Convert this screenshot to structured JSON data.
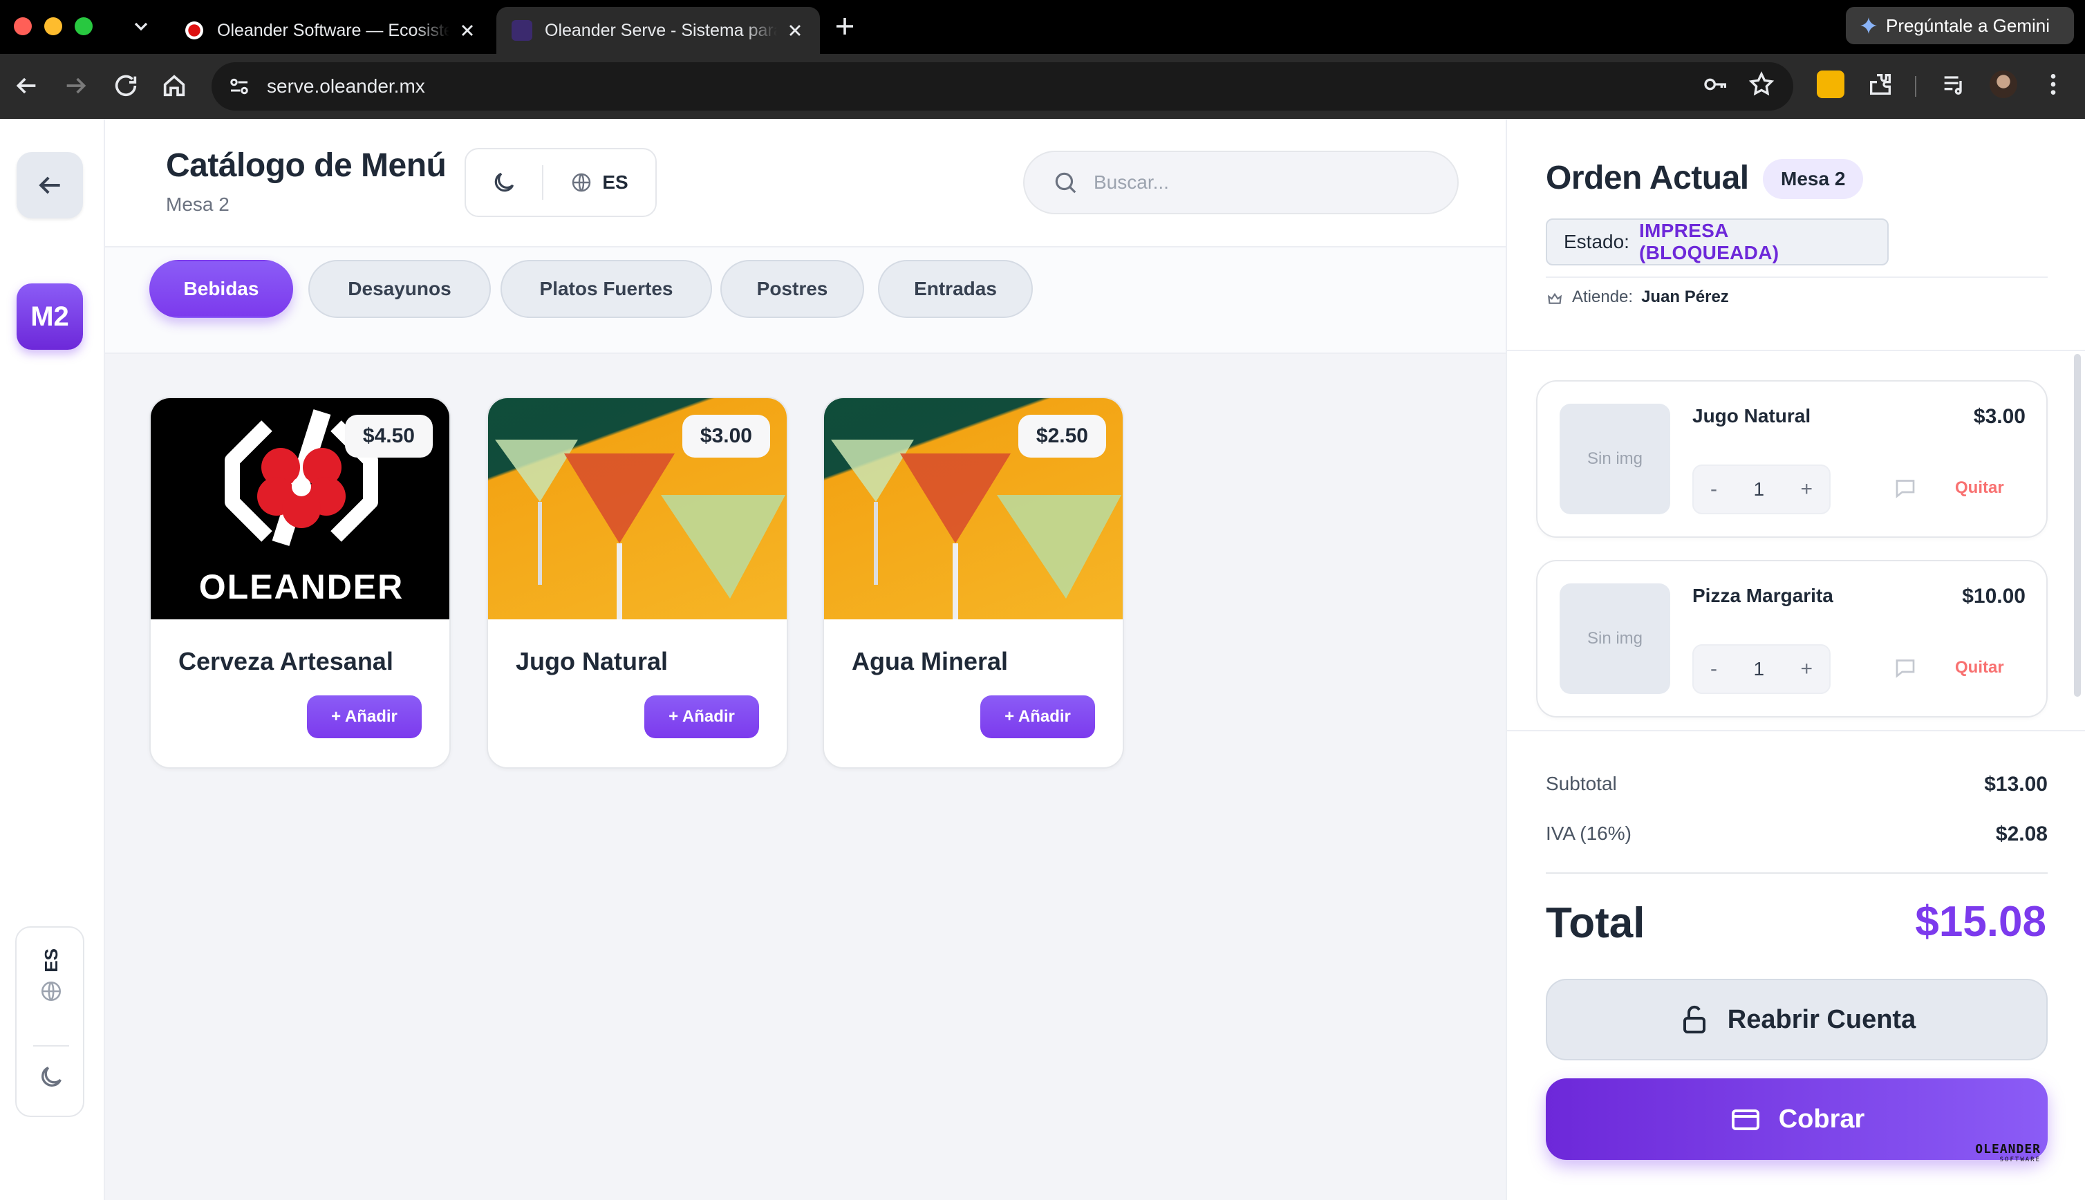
{
  "browser": {
    "tabs": [
      {
        "title": "Oleander Software — Ecosistema"
      },
      {
        "title": "Oleander Serve - Sistema para"
      }
    ],
    "gemini_label": "Pregúntale a Gemini",
    "url": "serve.oleander.mx"
  },
  "rail": {
    "badge": "M2",
    "lang": "ES"
  },
  "header": {
    "title": "Catálogo de Menú",
    "subtitle": "Mesa 2",
    "lang": "ES",
    "search_placeholder": "Buscar..."
  },
  "categories": [
    {
      "label": "Bebidas",
      "active": true
    },
    {
      "label": "Desayunos",
      "active": false
    },
    {
      "label": "Platos Fuertes",
      "active": false
    },
    {
      "label": "Postres",
      "active": false
    },
    {
      "label": "Entradas",
      "active": false
    }
  ],
  "products": [
    {
      "name": "Cerveza Artesanal",
      "price": "$4.50",
      "add_label": "+ Añadir",
      "image": "oleander-logo"
    },
    {
      "name": "Jugo Natural",
      "price": "$3.00",
      "add_label": "+ Añadir",
      "image": "cocktails"
    },
    {
      "name": "Agua Mineral",
      "price": "$2.50",
      "add_label": "+ Añadir",
      "image": "cocktails"
    }
  ],
  "order": {
    "title": "Orden Actual",
    "table": "Mesa 2",
    "status_label": "Estado:",
    "status_value": "IMPRESA (BLOQUEADA)",
    "attends_label": "Atiende:",
    "attends_name": "Juan Pérez",
    "items": [
      {
        "name": "Jugo Natural",
        "price": "$3.00",
        "qty": "1",
        "thumb": "Sin img",
        "remove": "Quitar"
      },
      {
        "name": "Pizza Margarita",
        "price": "$10.00",
        "qty": "1",
        "thumb": "Sin img",
        "remove": "Quitar"
      }
    ],
    "subtotal_label": "Subtotal",
    "subtotal": "$13.00",
    "tax_label": "IVA (16%)",
    "tax": "$2.08",
    "total_label": "Total",
    "total": "$15.08",
    "reopen_label": "Reabrir Cuenta",
    "pay_label": "Cobrar",
    "watermark": "OLEANDER",
    "watermark_sub": "SOFTWARE"
  },
  "colors": {
    "accent": "#7c3aed",
    "remove": "#f87171"
  }
}
